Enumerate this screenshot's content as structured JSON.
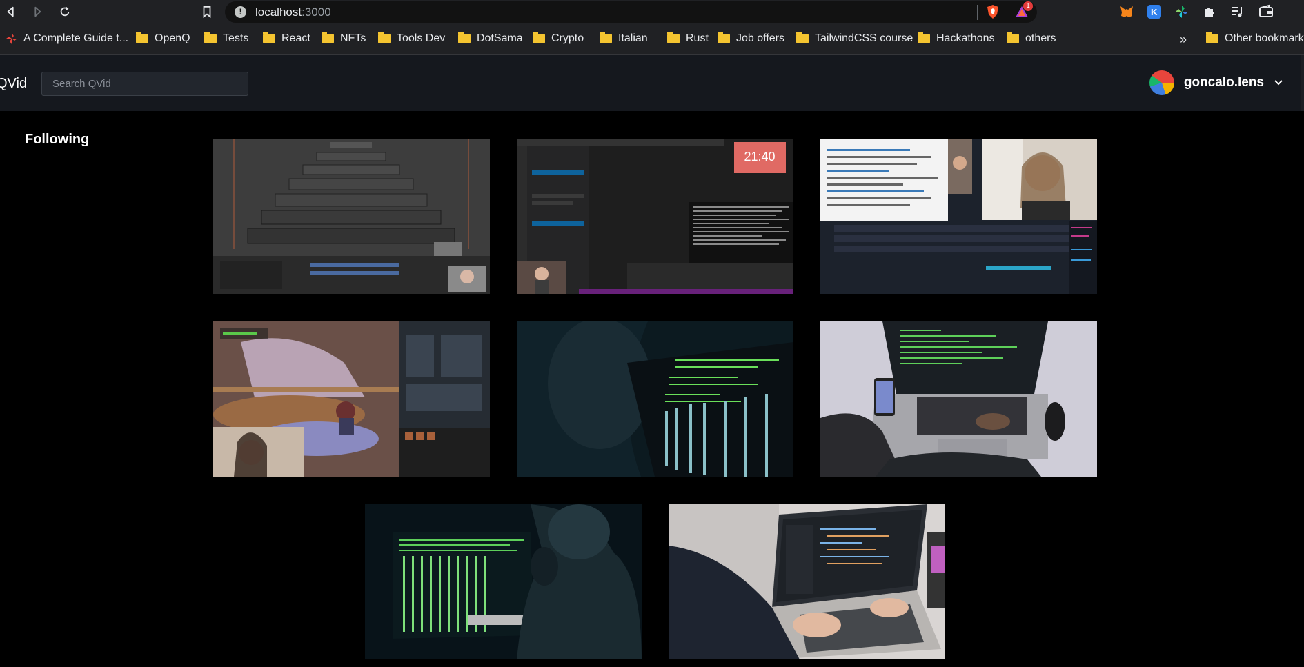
{
  "browser": {
    "url_host": "localhost",
    "url_port": ":3000",
    "notification_count": "1",
    "bookmarks": [
      "A Complete Guide t...",
      "OpenQ",
      "Tests",
      "React",
      "NFTs",
      "Tools Dev",
      "DotSama",
      "Crypto",
      "Italian",
      "Rust",
      "Job offers",
      "TailwindCSS course",
      "Hackathons",
      "others"
    ],
    "more_bookmarks": "»",
    "other_bookmarks": "Other bookmarks"
  },
  "app": {
    "logo": "QVid",
    "search_placeholder": "Search QVid",
    "username": "goncalo.lens"
  },
  "main": {
    "section_title": "Following",
    "videos": [
      {
        "scene": "OBS recording screen with recursive windows"
      },
      {
        "scene": "Code editor with timer 21:40 and webcam"
      },
      {
        "scene": "Streaming dashboard with webcam of woman smiling"
      },
      {
        "scene": "Video game scene with webcam overlay"
      },
      {
        "scene": "Person looking at terminal screens"
      },
      {
        "scene": "Laptop with green code and phone in hand"
      },
      {
        "scene": "Hooded person in front of green terminal"
      },
      {
        "scene": "Hands typing on laptop with code editor"
      }
    ],
    "timer_text": "21:40"
  },
  "colors": {
    "background": "#000000",
    "header": "#15181e",
    "browser_chrome": "#202124",
    "folder": "#f4c430"
  }
}
